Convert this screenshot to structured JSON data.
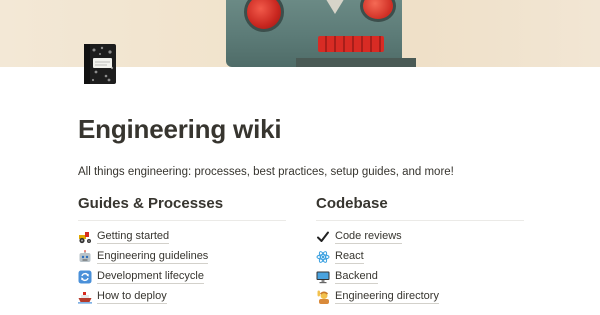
{
  "page": {
    "title": "Engineering wiki",
    "description": "All things engineering: processes, best practices, setup guides, and more!",
    "icon": "notebook-icon"
  },
  "columns": [
    {
      "heading": "Guides & Processes",
      "items": [
        {
          "label": "Getting started",
          "icon": "tractor-icon"
        },
        {
          "label": "Engineering guidelines",
          "icon": "robot-icon"
        },
        {
          "label": "Development lifecycle",
          "icon": "cycle-arrows-icon"
        },
        {
          "label": "How to deploy",
          "icon": "ship-icon"
        }
      ]
    },
    {
      "heading": "Codebase",
      "items": [
        {
          "label": "Code reviews",
          "icon": "checkmark-icon"
        },
        {
          "label": "React",
          "icon": "atom-icon"
        },
        {
          "label": "Backend",
          "icon": "desktop-computer-icon"
        },
        {
          "label": "Engineering directory",
          "icon": "person-raising-hand-icon"
        }
      ]
    }
  ],
  "colors": {
    "text": "#37352f",
    "divider": "#ebeae7",
    "link_underline": "#d3d1cb",
    "robot_red": "#c8261f",
    "robot_teal": "#5c7b77",
    "cover_bg": "#f1e3cc"
  }
}
